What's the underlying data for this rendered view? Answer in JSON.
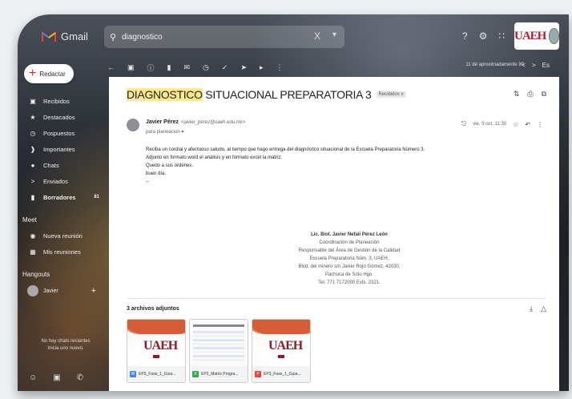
{
  "app": {
    "name": "Gmail",
    "brand_logo": "UAEH"
  },
  "search": {
    "value": "diagnostico",
    "clear_glyph": "X"
  },
  "compose": {
    "label": "Redactar"
  },
  "sidebar": {
    "items": [
      {
        "icon": "inbox-icon",
        "label": "Recibidos",
        "bold": false
      },
      {
        "icon": "star-icon",
        "label": "Destacados",
        "bold": false
      },
      {
        "icon": "clock-icon",
        "label": "Pospuestos",
        "bold": false
      },
      {
        "icon": "label-important-icon",
        "label": "Importantes",
        "bold": false
      },
      {
        "icon": "chat-icon",
        "label": "Chats",
        "bold": false
      },
      {
        "icon": "send-icon",
        "label": "Enviados",
        "bold": false
      },
      {
        "icon": "draft-icon",
        "label": "Borradores",
        "bold": true,
        "count": "81"
      }
    ],
    "meet_title": "Meet",
    "meet_items": [
      {
        "icon": "video-icon",
        "label": "Nueva reunión"
      },
      {
        "icon": "calendar-icon",
        "label": "Mis reuniones"
      }
    ],
    "hangouts_title": "Hangouts",
    "hangouts_user": "Javier",
    "no_chats_line1": "No hay chats recientes",
    "no_chats_line2": "Inicia uno nuevo."
  },
  "toolbar": {
    "pager": "11 de aproximadamente 90"
  },
  "email": {
    "subject_highlight": "DIAGNOSTICO",
    "subject_rest": " SITUACIONAL PREPARATORIA 3",
    "label": "Recibidos x",
    "sender_name": "Javier Pérez",
    "sender_email": "<javier_perez@uaeh.edu.mx>",
    "to_line": "para planeacion ▾",
    "date": "vie, 9 oct. 11:30",
    "body_line_1": "Reciba un cordial y afectuoso saludo, al tiempo que hago entrega del diagnóstico situacional de la Escuela Preparatoria Número 3.",
    "body_line_2": "Adjunto en formato word el análisis y en formato excel la matriz.",
    "body_line_3": "Quedo a sus ordenes.",
    "body_line_4": "buen día.",
    "body_line_5": "--",
    "signature": {
      "name": "Lic. Biol. Javier Nefalí Pérez León",
      "line1": "Coordinación de Planeación",
      "line2": "Responsable del Área de Gestión de la Calidad",
      "line3": "Escuela Preparatoria Núm. 3, UAEH,",
      "line4": "Blvd. del minero s/n Javier Rojo Gómez, 42030,",
      "line5": "Pachuca de Soto Hgo.",
      "line6": "Tel. 771 7172000 Exts. 2321."
    }
  },
  "attachments": {
    "title": "3 archivos adjuntos",
    "items": [
      {
        "type": "word",
        "badge": "W",
        "name": "EP3_Fase_1_Guia...",
        "color": "#4a86e8"
      },
      {
        "type": "sheet",
        "badge": "X",
        "name": "EP3_Matriz Progra...",
        "color": "#34a853"
      },
      {
        "type": "pdf",
        "badge": "P",
        "name": "EP3_Fase_1_Guia...",
        "color": "#ea4335"
      }
    ]
  },
  "colors": {
    "highlight": "#ffe98a",
    "brand_red": "#b01e2e",
    "compose_plus": "#d93025"
  }
}
